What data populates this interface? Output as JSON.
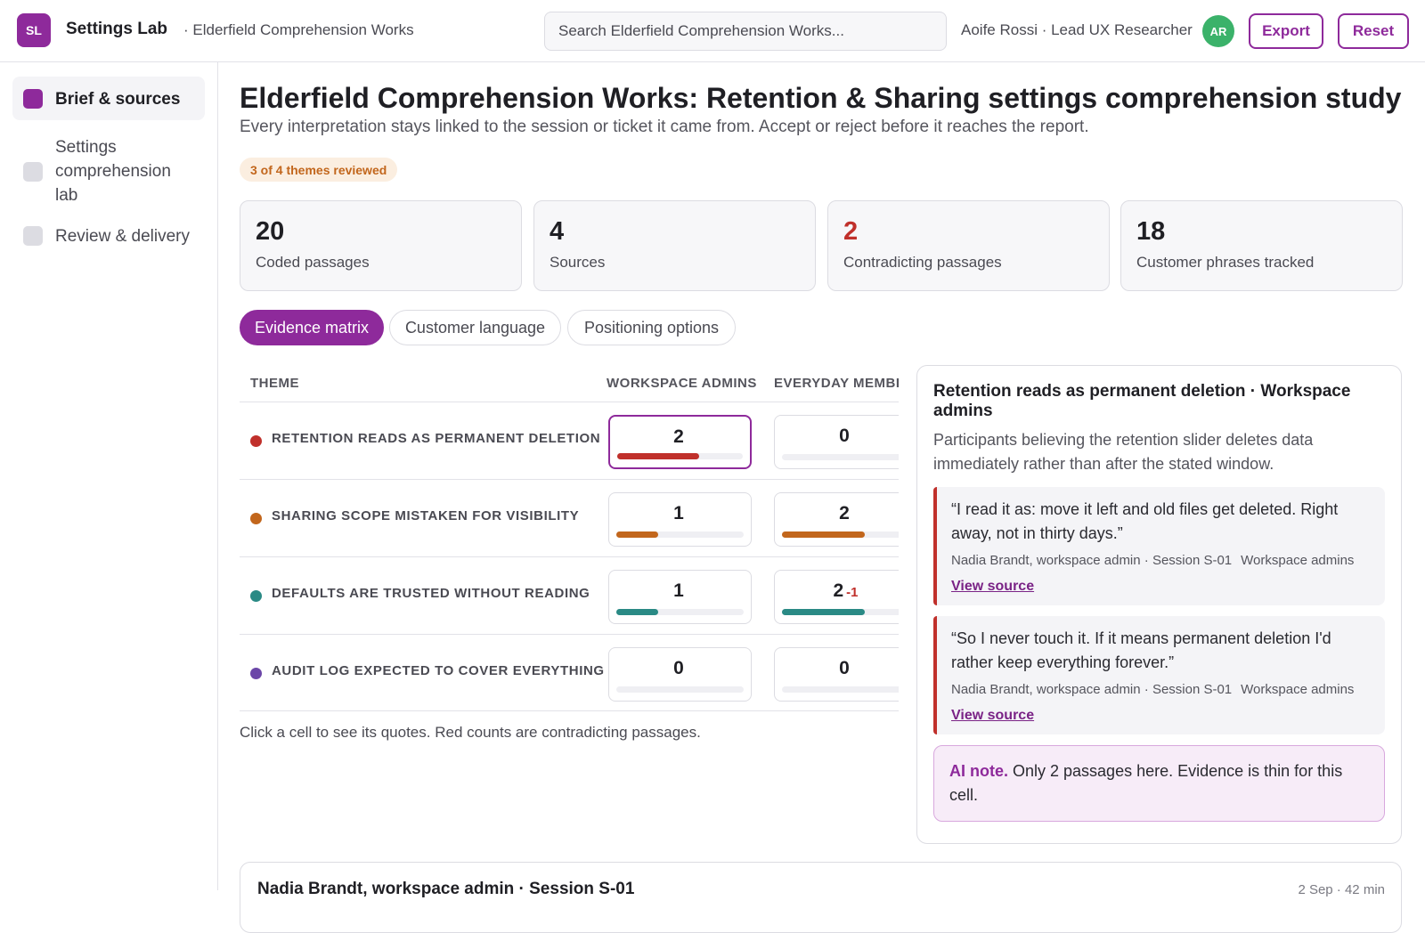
{
  "app": {
    "logo": "SL",
    "title": "Settings Lab",
    "crumb": "· Elderfield Comprehension Works"
  },
  "search": {
    "placeholder": "Search Elderfield Comprehension Works..."
  },
  "user": {
    "label": "Aoife Rossi · Lead UX Researcher",
    "initials": "AR"
  },
  "actions": {
    "export": "Export",
    "reset": "Reset"
  },
  "sidebar": {
    "items": [
      {
        "label": "Brief & sources",
        "active": true
      },
      {
        "label": "Settings comprehension lab",
        "active": false
      },
      {
        "label": "Review & delivery",
        "active": false
      }
    ]
  },
  "page": {
    "title": "Elderfield Comprehension Works: Retention & Sharing settings comprehension study",
    "subtitle": "Every interpretation stays linked to the session or ticket it came from. Accept or reject before it reaches the report.",
    "progress": "3 of 4 themes reviewed"
  },
  "stats": [
    {
      "value": "20",
      "label": "Coded passages",
      "alert": false
    },
    {
      "value": "4",
      "label": "Sources",
      "alert": false
    },
    {
      "value": "2",
      "label": "Contradicting passages",
      "alert": true
    },
    {
      "value": "18",
      "label": "Customer phrases tracked",
      "alert": false
    }
  ],
  "tabs": [
    {
      "label": "Evidence matrix",
      "active": true
    },
    {
      "label": "Customer language",
      "active": false
    },
    {
      "label": "Positioning options",
      "active": false
    }
  ],
  "matrix": {
    "headers": {
      "theme": "THEME",
      "col1": "WORKSPACE ADMINS",
      "col2": "EVERYDAY MEMBE"
    },
    "max_count": 4,
    "rows": [
      {
        "theme": "RETENTION READS AS PERMANENT DELETION",
        "color": "#c0302b",
        "c1": {
          "count": "2",
          "contra": "",
          "level": 0.65
        },
        "c2": {
          "count": "0",
          "contra": "",
          "level": 0
        }
      },
      {
        "theme": "SHARING SCOPE MISTAKEN FOR VISIBILITY",
        "color": "#c2661c",
        "c1": {
          "count": "1",
          "contra": "",
          "level": 0.33
        },
        "c2": {
          "count": "2",
          "contra": "",
          "level": 0.65
        }
      },
      {
        "theme": "DEFAULTS ARE TRUSTED WITHOUT READING",
        "color": "#2a8a85",
        "c1": {
          "count": "1",
          "contra": "",
          "level": 0.33
        },
        "c2": {
          "count": "2",
          "contra": "-1",
          "level": 0.65
        }
      },
      {
        "theme": "AUDIT LOG EXPECTED TO COVER EVERYTHING",
        "color": "#6b46a8",
        "c1": {
          "count": "0",
          "contra": "",
          "level": 0
        },
        "c2": {
          "count": "0",
          "contra": "",
          "level": 0
        }
      }
    ],
    "hint": "Click a cell to see its quotes. Red counts are contradicting passages."
  },
  "panel": {
    "title": "Retention reads as permanent deletion · Workspace admins",
    "description": "Participants believing the retention slider deletes data immediately rather than after the stated window.",
    "quotes": [
      {
        "text": "“I read it as: move it left and old files get deleted. Right away, not in thirty days.”",
        "source": "Nadia Brandt, workspace admin · Session S-01",
        "segment": "Workspace admins",
        "link": "View source"
      },
      {
        "text": "“So I never touch it. If it means permanent deletion I'd rather keep everything forever.”",
        "source": "Nadia Brandt, workspace admin · Session S-01",
        "segment": "Workspace admins",
        "link": "View source"
      }
    ],
    "ai_note": {
      "label": "AI note.",
      "text": " Only 2 passages here. Evidence is thin for this cell."
    }
  },
  "bottom": {
    "title": "Nadia Brandt, workspace admin · Session S-01",
    "meta": "2 Sep · 42 min"
  }
}
